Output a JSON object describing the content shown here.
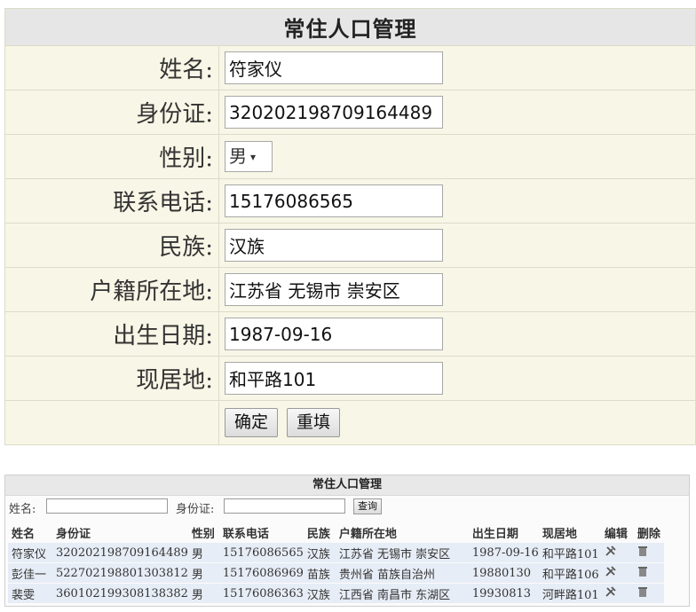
{
  "form": {
    "title": "常住人口管理",
    "fields": [
      {
        "label": "姓名:",
        "value": "符家仪"
      },
      {
        "label": "身份证:",
        "value": "320202198709164489"
      },
      {
        "label": "性别:",
        "value": "男"
      },
      {
        "label": "联系电话:",
        "value": "15176086565"
      },
      {
        "label": "民族:",
        "value": "汉族"
      },
      {
        "label": "户籍所在地:",
        "value": "江苏省 无锡市 崇安区"
      },
      {
        "label": "出生日期:",
        "value": "1987-09-16"
      },
      {
        "label": "现居地:",
        "value": "和平路101"
      }
    ],
    "gender_arrow": "▾",
    "submit_label": "确定",
    "reset_label": "重填"
  },
  "list": {
    "title": "常住人口管理",
    "search": {
      "name_label": "姓名:",
      "id_label": "身份证:",
      "button_label": "查询",
      "name_value": "",
      "id_value": ""
    },
    "headers": [
      "姓名",
      "身份证",
      "性别",
      "联系电话",
      "民族",
      "户籍所在地",
      "出生日期",
      "现居地",
      "编辑",
      "删除"
    ],
    "rows": [
      [
        "符家仪",
        "320202198709164489",
        "男",
        "15176086565",
        "汉族",
        "江苏省 无锡市 崇安区",
        "1987-09-16",
        "和平路101"
      ],
      [
        "彭佳一",
        "522702198801303812",
        "男",
        "15176086969",
        "苗族",
        "贵州省 苗族自治州",
        "19880130",
        "和平路106"
      ],
      [
        "裴雯",
        "360102199308138382",
        "男",
        "15176086363",
        "汉族",
        "江西省 南昌市 东湖区",
        "19930813",
        "河畔路101"
      ]
    ],
    "edit_icon": "edit-icon",
    "delete_icon": "trash-icon"
  }
}
